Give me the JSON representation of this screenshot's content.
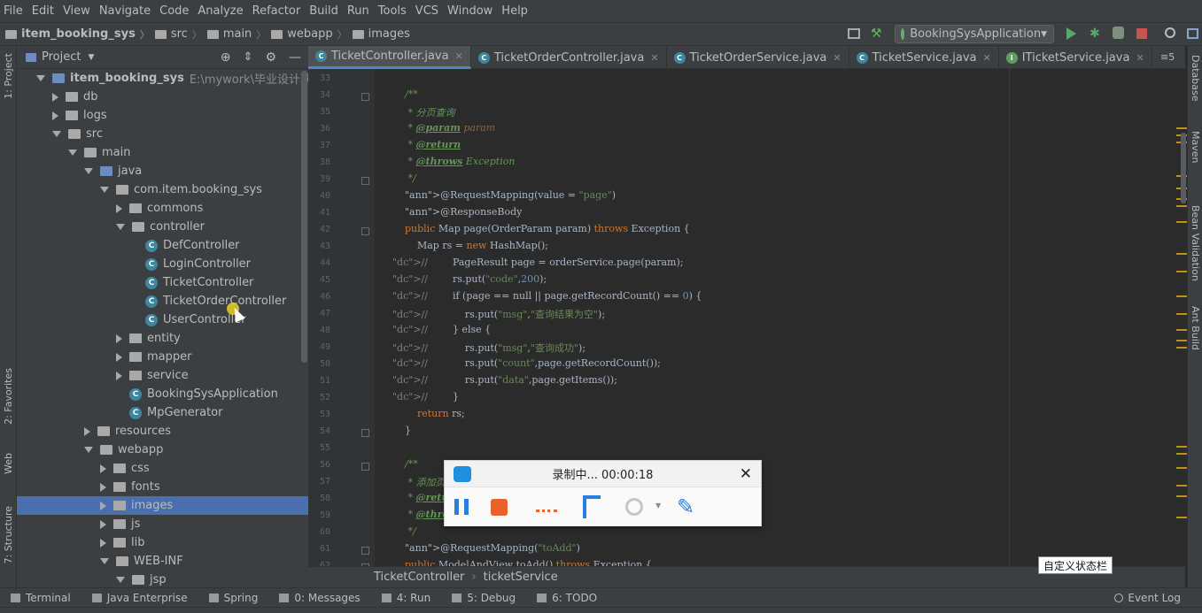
{
  "menu": [
    "File",
    "Edit",
    "View",
    "Navigate",
    "Code",
    "Analyze",
    "Refactor",
    "Build",
    "Run",
    "Tools",
    "VCS",
    "Window",
    "Help"
  ],
  "nav": {
    "crumbs": [
      "item_booking_sys",
      "src",
      "main",
      "webapp",
      "images"
    ],
    "run_config": "BookingSysApplication"
  },
  "left_stripe": {
    "project": "1: Project",
    "favorites": "2: Favorites",
    "web": "Web",
    "structure": "7: Structure"
  },
  "right_stripe": [
    "Database",
    "Maven",
    "Bean Validation",
    "Ant Build"
  ],
  "project_panel": {
    "title": "Project",
    "tree": [
      {
        "label": "item_booking_sys",
        "path": "E:\\mywork\\毕业设计项目\\火车",
        "depth": 0,
        "icon": "folder-blue",
        "arrow": "d",
        "bold": true
      },
      {
        "label": "db",
        "depth": 1,
        "icon": "folder",
        "arrow": "r"
      },
      {
        "label": "logs",
        "depth": 1,
        "icon": "folder",
        "arrow": "r"
      },
      {
        "label": "src",
        "depth": 1,
        "icon": "folder",
        "arrow": "d"
      },
      {
        "label": "main",
        "depth": 2,
        "icon": "folder",
        "arrow": "d"
      },
      {
        "label": "java",
        "depth": 3,
        "icon": "folder-blue",
        "arrow": "d"
      },
      {
        "label": "com.item.booking_sys",
        "depth": 4,
        "icon": "folder",
        "arrow": "d"
      },
      {
        "label": "commons",
        "depth": 5,
        "icon": "folder",
        "arrow": "r"
      },
      {
        "label": "controller",
        "depth": 5,
        "icon": "folder",
        "arrow": "d"
      },
      {
        "label": "DefController",
        "depth": 6,
        "icon": "class"
      },
      {
        "label": "LoginController",
        "depth": 6,
        "icon": "class"
      },
      {
        "label": "TicketController",
        "depth": 6,
        "icon": "class"
      },
      {
        "label": "TicketOrderController",
        "depth": 6,
        "icon": "class"
      },
      {
        "label": "UserController",
        "depth": 6,
        "icon": "class"
      },
      {
        "label": "entity",
        "depth": 5,
        "icon": "folder",
        "arrow": "r"
      },
      {
        "label": "mapper",
        "depth": 5,
        "icon": "folder",
        "arrow": "r"
      },
      {
        "label": "service",
        "depth": 5,
        "icon": "folder",
        "arrow": "r"
      },
      {
        "label": "BookingSysApplication",
        "depth": 5,
        "icon": "class"
      },
      {
        "label": "MpGenerator",
        "depth": 5,
        "icon": "class"
      },
      {
        "label": "resources",
        "depth": 3,
        "icon": "folder",
        "arrow": "r"
      },
      {
        "label": "webapp",
        "depth": 3,
        "icon": "folder",
        "arrow": "d"
      },
      {
        "label": "css",
        "depth": 4,
        "icon": "folder",
        "arrow": "r"
      },
      {
        "label": "fonts",
        "depth": 4,
        "icon": "folder",
        "arrow": "r"
      },
      {
        "label": "images",
        "depth": 4,
        "icon": "folder",
        "arrow": "r",
        "selected": true
      },
      {
        "label": "js",
        "depth": 4,
        "icon": "folder",
        "arrow": "r"
      },
      {
        "label": "lib",
        "depth": 4,
        "icon": "folder",
        "arrow": "r"
      },
      {
        "label": "WEB-INF",
        "depth": 4,
        "icon": "folder",
        "arrow": "d"
      },
      {
        "label": "jsp",
        "depth": 5,
        "icon": "folder",
        "arrow": "d"
      }
    ]
  },
  "tabs": [
    {
      "label": "TicketController.java",
      "active": true,
      "icon": "C"
    },
    {
      "label": "TicketOrderController.java",
      "icon": "C"
    },
    {
      "label": "TicketOrderService.java",
      "icon": "C"
    },
    {
      "label": "TicketService.java",
      "icon": "C"
    },
    {
      "label": "ITicketService.java",
      "icon": "I"
    }
  ],
  "tab_overflow": "5",
  "editor": {
    "line_start": 33,
    "lines": [
      "",
      "    /**",
      "     * 分页查询",
      "     * @param param",
      "     * @return",
      "     * @throws Exception",
      "     */",
      "    @RequestMapping(value = \"page\")",
      "    @ResponseBody",
      "    public Map page(OrderParam param) throws Exception {",
      "        Map rs = new HashMap();",
      "//        PageResult page = orderService.page(param);",
      "//        rs.put(\"code\",200);",
      "//        if (page == null || page.getRecordCount() == 0) {",
      "//            rs.put(\"msg\",\"查询结果为空\");",
      "//        } else {",
      "//            rs.put(\"msg\",\"查询成功\");",
      "//            rs.put(\"count\",page.getRecordCount());",
      "//            rs.put(\"data\",page.getItems());",
      "//        }",
      "        return rs;",
      "    }",
      "",
      "    /**",
      "     * 添加页面",
      "     * @return",
      "     * @throws Exception",
      "     */",
      "    @RequestMapping(\"toAdd\")",
      "    public ModelAndView toAdd() throws Exception {"
    ]
  },
  "editor_breadcrumb": [
    "TicketController",
    "ticketService"
  ],
  "bottom_tools": [
    "Terminal",
    "Java Enterprise",
    "Spring",
    "0: Messages",
    "4: Run",
    "5: Debug",
    "6: TODO"
  ],
  "event_log": "Event Log",
  "recorder": {
    "status": "录制中... 00:00:18"
  },
  "custom_statusbar_tip": "自定义状态栏",
  "colors": {
    "accent": "#4a88c7",
    "selection": "#4b6eaf",
    "background": "#2b2b2b",
    "panel": "#3c3f41"
  }
}
